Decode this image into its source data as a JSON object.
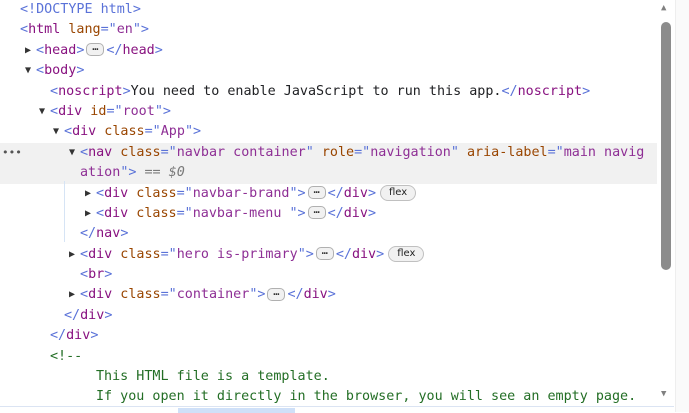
{
  "lines": [
    {
      "level": 0,
      "tokens": [
        [
          "b",
          "<!DOCTYPE html>"
        ]
      ]
    },
    {
      "level": 0,
      "tokens": [
        [
          "b",
          "<"
        ],
        [
          "t",
          "html"
        ],
        [
          "an",
          " lang"
        ],
        [
          "b",
          "=\""
        ],
        [
          "av",
          "en"
        ],
        [
          "b",
          "\">"
        ]
      ]
    },
    {
      "level": 1,
      "toggle": "collapsed",
      "tokens": [
        [
          "b",
          "<"
        ],
        [
          "t",
          "head"
        ],
        [
          "b",
          ">"
        ],
        [
          "e",
          "…"
        ],
        [
          "b",
          "</"
        ],
        [
          "t",
          "head"
        ],
        [
          "b",
          ">"
        ]
      ]
    },
    {
      "level": 1,
      "toggle": "expanded",
      "tokens": [
        [
          "b",
          "<"
        ],
        [
          "t",
          "body"
        ],
        [
          "b",
          ">"
        ]
      ]
    },
    {
      "level": 2,
      "tokens": [
        [
          "b",
          "<"
        ],
        [
          "t",
          "noscript"
        ],
        [
          "b",
          ">"
        ],
        [
          "tx",
          "You need to enable JavaScript to run this app."
        ],
        [
          "b",
          "</"
        ],
        [
          "t",
          "noscript"
        ],
        [
          "b",
          ">"
        ]
      ]
    },
    {
      "level": 2,
      "toggle": "expanded",
      "tokens": [
        [
          "b",
          "<"
        ],
        [
          "t",
          "div"
        ],
        [
          "an",
          " id"
        ],
        [
          "b",
          "=\""
        ],
        [
          "av",
          "root"
        ],
        [
          "b",
          "\">"
        ]
      ]
    },
    {
      "level": 3,
      "toggle": "expanded",
      "tokens": [
        [
          "b",
          "<"
        ],
        [
          "t",
          "div"
        ],
        [
          "an",
          " class"
        ],
        [
          "b",
          "=\""
        ],
        [
          "av",
          "App"
        ],
        [
          "b",
          "\">"
        ]
      ]
    },
    {
      "level": 4,
      "toggle": "expanded",
      "selected": true,
      "tokens": [
        [
          "b",
          "<"
        ],
        [
          "t",
          "nav"
        ],
        [
          "an",
          " class"
        ],
        [
          "b",
          "=\""
        ],
        [
          "av",
          "navbar container"
        ],
        [
          "b",
          "\""
        ],
        [
          "an",
          " role"
        ],
        [
          "b",
          "=\""
        ],
        [
          "av",
          "navigation"
        ],
        [
          "b",
          "\""
        ],
        [
          "an",
          " aria-label"
        ],
        [
          "b",
          "=\""
        ],
        [
          "av",
          "main navig"
        ]
      ]
    },
    {
      "level": 4,
      "selected": true,
      "tokens": [
        [
          "av",
          "ation"
        ],
        [
          "b",
          "\">"
        ],
        [
          "eq",
          " == $0"
        ]
      ]
    },
    {
      "level": 5,
      "toggle": "collapsed",
      "tokens": [
        [
          "b",
          "<"
        ],
        [
          "t",
          "div"
        ],
        [
          "an",
          " class"
        ],
        [
          "b",
          "=\""
        ],
        [
          "av",
          "navbar-brand"
        ],
        [
          "b",
          "\">"
        ],
        [
          "e",
          "…"
        ],
        [
          "b",
          "</"
        ],
        [
          "t",
          "div"
        ],
        [
          "b",
          ">"
        ],
        [
          "badge",
          "flex"
        ]
      ]
    },
    {
      "level": 5,
      "toggle": "collapsed",
      "tokens": [
        [
          "b",
          "<"
        ],
        [
          "t",
          "div"
        ],
        [
          "an",
          " class"
        ],
        [
          "b",
          "=\""
        ],
        [
          "av",
          "navbar-menu "
        ],
        [
          "b",
          "\">"
        ],
        [
          "e",
          "…"
        ],
        [
          "b",
          "</"
        ],
        [
          "t",
          "div"
        ],
        [
          "b",
          ">"
        ]
      ]
    },
    {
      "level": 4,
      "tokens": [
        [
          "b",
          "</"
        ],
        [
          "t",
          "nav"
        ],
        [
          "b",
          ">"
        ]
      ]
    },
    {
      "level": 4,
      "toggle": "collapsed",
      "tokens": [
        [
          "b",
          "<"
        ],
        [
          "t",
          "div"
        ],
        [
          "an",
          " class"
        ],
        [
          "b",
          "=\""
        ],
        [
          "av",
          "hero is-primary"
        ],
        [
          "b",
          "\">"
        ],
        [
          "e",
          "…"
        ],
        [
          "b",
          "</"
        ],
        [
          "t",
          "div"
        ],
        [
          "b",
          ">"
        ],
        [
          "badge",
          "flex"
        ]
      ]
    },
    {
      "level": 4,
      "tokens": [
        [
          "b",
          "<"
        ],
        [
          "t",
          "br"
        ],
        [
          "b",
          ">"
        ]
      ]
    },
    {
      "level": 4,
      "toggle": "collapsed",
      "tokens": [
        [
          "b",
          "<"
        ],
        [
          "t",
          "div"
        ],
        [
          "an",
          " class"
        ],
        [
          "b",
          "=\""
        ],
        [
          "av",
          "container"
        ],
        [
          "b",
          "\">"
        ],
        [
          "e",
          "…"
        ],
        [
          "b",
          "</"
        ],
        [
          "t",
          "div"
        ],
        [
          "b",
          ">"
        ]
      ]
    },
    {
      "level": 3,
      "tokens": [
        [
          "b",
          "</"
        ],
        [
          "t",
          "div"
        ],
        [
          "b",
          ">"
        ]
      ]
    },
    {
      "level": 2,
      "tokens": [
        [
          "b",
          "</"
        ],
        [
          "t",
          "div"
        ],
        [
          "b",
          ">"
        ]
      ]
    },
    {
      "level": 2,
      "tokens": [
        [
          "c",
          "<!--"
        ]
      ]
    },
    {
      "level": 5,
      "tokens": [
        [
          "c",
          "This HTML file is a template."
        ]
      ]
    },
    {
      "level": 5,
      "tokens": [
        [
          "c",
          "If you open it directly in the browser, you will see an empty page."
        ]
      ]
    }
  ],
  "colors": {
    "tag": "#881280",
    "bracket": "#5a72d8",
    "attr_name": "#994500",
    "attr_value": "#8e2f95",
    "comment": "#236e25",
    "selected_row": "#f1f1f1"
  },
  "icons": {
    "expanded": "triangle-down-icon",
    "collapsed": "triangle-right-icon",
    "more": "ellipsis-icon"
  }
}
